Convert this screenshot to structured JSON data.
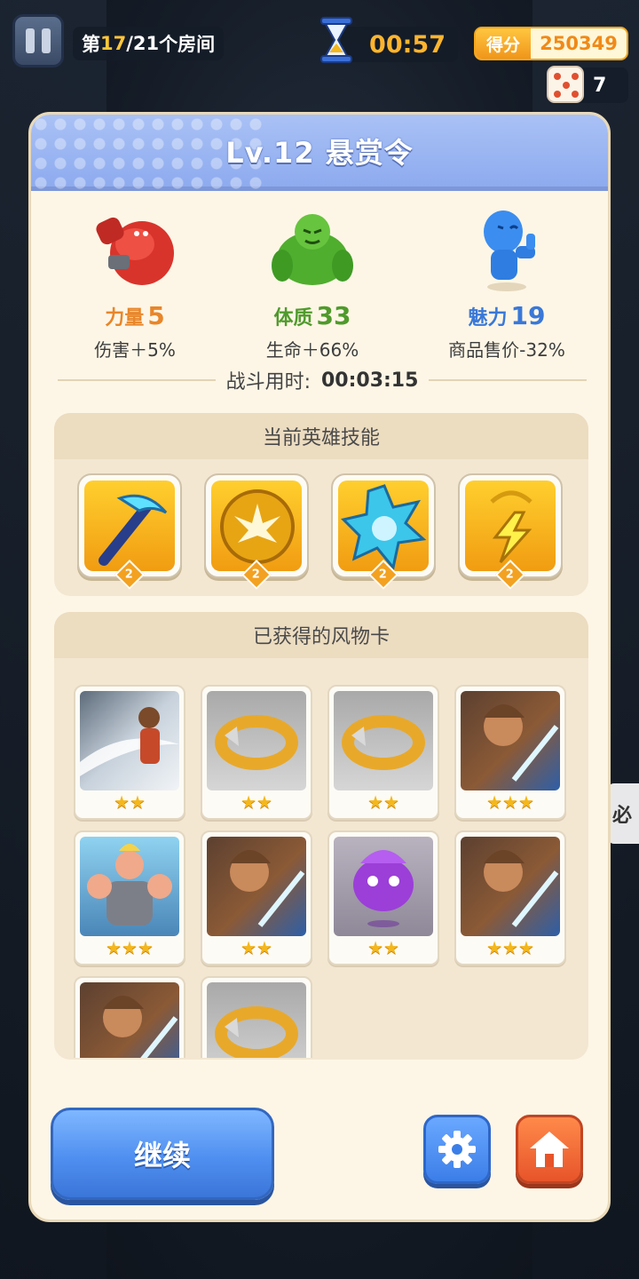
{
  "hud": {
    "room_prefix": "第",
    "room_current": "17",
    "room_sep": "/",
    "room_total": "21",
    "room_suffix": "个房间",
    "timer": "00:57",
    "score_label": "得分",
    "score_value": "250349",
    "dice_count": "7"
  },
  "side_tip": "必",
  "panel": {
    "title": "Lv.12 悬赏令",
    "stats": [
      {
        "name": "力量",
        "value": "5",
        "desc": "伤害＋5%",
        "icon": "red-boxing-monster"
      },
      {
        "name": "体质",
        "value": "33",
        "desc": "生命＋66%",
        "icon": "green-muscle-monster"
      },
      {
        "name": "魅力",
        "value": "19",
        "desc": "商品售价-32%",
        "icon": "blue-thumbs-up-figure"
      }
    ],
    "battle_time_label": "战斗用时:",
    "battle_time_value": "00:03:15",
    "skills_title": "当前英雄技能",
    "skills": [
      {
        "icon": "ice-pickaxe-icon",
        "level": "2"
      },
      {
        "icon": "gold-burst-orb-icon",
        "level": "2"
      },
      {
        "icon": "frost-star-icon",
        "level": "2"
      },
      {
        "icon": "lightning-amulet-icon",
        "level": "2"
      }
    ],
    "cards_title": "已获得的风物卡",
    "cards": [
      {
        "art": "blade-warrior",
        "stars": "★★"
      },
      {
        "art": "gold-ring",
        "stars": "★★"
      },
      {
        "art": "gold-ring",
        "stars": "★★"
      },
      {
        "art": "hero-swordsman",
        "stars": "★★★"
      },
      {
        "art": "muscle-man",
        "stars": "★★★"
      },
      {
        "art": "hero-swordsman",
        "stars": "★★"
      },
      {
        "art": "purple-ghost",
        "stars": "★★"
      },
      {
        "art": "hero-swordsman",
        "stars": "★★★"
      },
      {
        "art": "hero-swordsman",
        "stars": ""
      },
      {
        "art": "gold-ring",
        "stars": ""
      }
    ],
    "continue_label": "继续"
  },
  "colors": {
    "strength": "#e8862a",
    "constitution": "#4f9a2c",
    "charm": "#3a78d8",
    "header": "#8eabef",
    "star": "#f4b71c"
  }
}
